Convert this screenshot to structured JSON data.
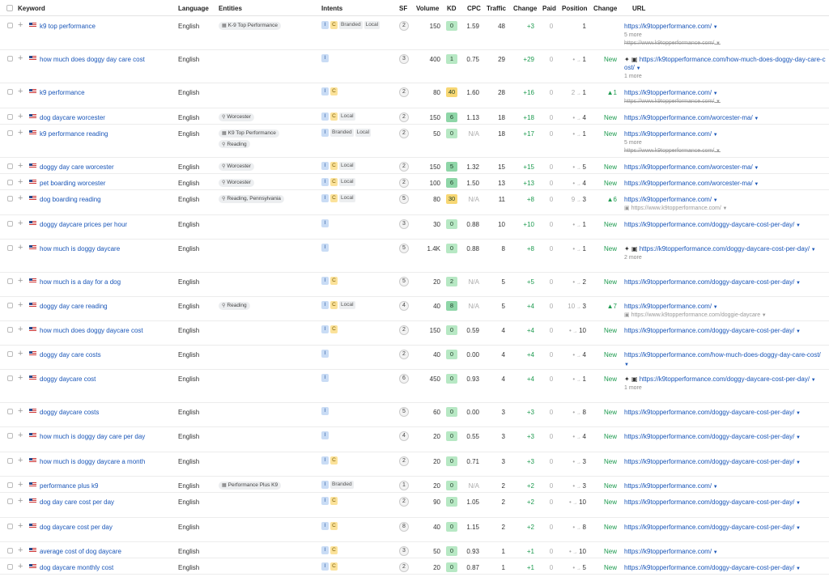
{
  "headers": {
    "keyword": "Keyword",
    "language": "Language",
    "entities": "Entities",
    "intents": "Intents",
    "sf": "SF",
    "volume": "Volume",
    "kd": "KD",
    "cpc": "CPC",
    "traffic": "Traffic",
    "change": "Change",
    "paid": "Paid",
    "position": "Position",
    "position_change": "Change",
    "url": "URL"
  },
  "colors": {
    "link": "#1a56b8",
    "positive": "#1c9a4e",
    "kd_green": "#8fd6a8",
    "kd_light_green": "#b7e8c4",
    "kd_yellow": "#f7d774"
  },
  "rows": [
    {
      "keyword": "k9 top performance",
      "language": "English",
      "entities": [
        {
          "icon": "building-icon",
          "label": "K-9 Top Performance"
        }
      ],
      "intents": [
        "I",
        "C",
        "Branded",
        "Local"
      ],
      "sf": "2",
      "volume": "150",
      "kd": "0",
      "cpc": "1.59",
      "traffic": "48",
      "change": "+3",
      "paid": "0",
      "pos_from": "",
      "pos_to": "1",
      "pos_change": "",
      "url": "https://k9topperformance.com/",
      "url_more": "5 more",
      "url_old": "https://www.k9topperformance.com/",
      "old_strike": true,
      "sparkle": false,
      "h": 41
    },
    {
      "keyword": "how much does doggy day care cost",
      "language": "English",
      "entities": [],
      "intents": [
        "I"
      ],
      "sf": "3",
      "volume": "400",
      "kd": "1",
      "cpc": "0.75",
      "traffic": "29",
      "change": "+29",
      "paid": "0",
      "pos_from": "•",
      "pos_to": "1",
      "pos_change": "New",
      "url": "https://k9topperformance.com/how-much-does-doggy-day-care-cost/",
      "url_more": "1 more",
      "url_old": "",
      "old_strike": false,
      "sparkle": true,
      "h": 41
    },
    {
      "keyword": "k9 performance",
      "language": "English",
      "entities": [],
      "intents": [
        "I",
        "C"
      ],
      "sf": "2",
      "volume": "80",
      "kd": "40",
      "cpc": "1.60",
      "traffic": "28",
      "change": "+16",
      "paid": "0",
      "pos_from": "2",
      "pos_to": "1",
      "pos_change": "▲1",
      "url": "https://k9topperformance.com/",
      "url_more": "",
      "url_old": "https://www.k9topperformance.com/",
      "old_strike": true,
      "sparkle": false,
      "h": 31
    },
    {
      "keyword": "dog daycare worcester",
      "language": "English",
      "entities": [
        {
          "icon": "pin-icon",
          "label": "Worcester"
        }
      ],
      "intents": [
        "I",
        "C",
        "Local"
      ],
      "sf": "2",
      "volume": "150",
      "kd": "6",
      "cpc": "1.13",
      "traffic": "18",
      "change": "+18",
      "paid": "0",
      "pos_from": "•",
      "pos_to": "4",
      "pos_change": "New",
      "url": "https://k9topperformance.com/worcester-ma/",
      "url_more": "",
      "url_old": "",
      "old_strike": false,
      "sparkle": false,
      "h": 20
    },
    {
      "keyword": "k9 performance reading",
      "language": "English",
      "entities": [
        {
          "icon": "building-icon",
          "label": "K9 Top Performance"
        },
        {
          "icon": "pin-icon",
          "label": "Reading"
        }
      ],
      "intents": [
        "I",
        "Branded",
        "Local"
      ],
      "sf": "2",
      "volume": "50",
      "kd": "0",
      "cpc": "N/A",
      "traffic": "18",
      "change": "+17",
      "paid": "0",
      "pos_from": "•",
      "pos_to": "1",
      "pos_change": "New",
      "url": "https://k9topperformance.com/",
      "url_more": "5 more",
      "url_old": "https://www.k9topperformance.com/",
      "old_strike": true,
      "sparkle": false,
      "h": 41
    },
    {
      "keyword": "doggy day care worcester",
      "language": "English",
      "entities": [
        {
          "icon": "pin-icon",
          "label": "Worcester"
        }
      ],
      "intents": [
        "I",
        "C",
        "Local"
      ],
      "sf": "2",
      "volume": "150",
      "kd": "5",
      "cpc": "1.32",
      "traffic": "15",
      "change": "+15",
      "paid": "0",
      "pos_from": "•",
      "pos_to": "5",
      "pos_change": "New",
      "url": "https://k9topperformance.com/worcester-ma/",
      "url_more": "",
      "url_old": "",
      "old_strike": false,
      "sparkle": false,
      "h": 20
    },
    {
      "keyword": "pet boarding worcester",
      "language": "English",
      "entities": [
        {
          "icon": "pin-icon",
          "label": "Worcester"
        }
      ],
      "intents": [
        "I",
        "C",
        "Local"
      ],
      "sf": "2",
      "volume": "100",
      "kd": "6",
      "cpc": "1.50",
      "traffic": "13",
      "change": "+13",
      "paid": "0",
      "pos_from": "•",
      "pos_to": "4",
      "pos_change": "New",
      "url": "https://k9topperformance.com/worcester-ma/",
      "url_more": "",
      "url_old": "",
      "old_strike": false,
      "sparkle": false,
      "h": 20
    },
    {
      "keyword": "dog boarding reading",
      "language": "English",
      "entities": [
        {
          "icon": "pin-icon",
          "label": "Reading, Pennsylvania"
        }
      ],
      "intents": [
        "I",
        "C",
        "Local"
      ],
      "sf": "5",
      "volume": "80",
      "kd": "30",
      "cpc": "N/A",
      "traffic": "11",
      "change": "+8",
      "paid": "0",
      "pos_from": "9",
      "pos_to": "3",
      "pos_change": "▲6",
      "url": "https://k9topperformance.com/",
      "url_more": "",
      "url_old": "https://www.k9topperformance.com/",
      "old_strike": false,
      "sparkle": false,
      "h": 31
    },
    {
      "keyword": "doggy daycare prices per hour",
      "language": "English",
      "entities": [],
      "intents": [
        "I"
      ],
      "sf": "3",
      "volume": "30",
      "kd": "0",
      "cpc": "0.88",
      "traffic": "10",
      "change": "+10",
      "paid": "0",
      "pos_from": "•",
      "pos_to": "1",
      "pos_change": "New",
      "url": "https://k9topperformance.com/doggy-daycare-cost-per-day/",
      "url_more": "",
      "url_old": "",
      "old_strike": false,
      "sparkle": false,
      "h": 30
    },
    {
      "keyword": "how much is doggy daycare",
      "language": "English",
      "entities": [],
      "intents": [
        "I"
      ],
      "sf": "5",
      "volume": "1.4K",
      "kd": "0",
      "cpc": "0.88",
      "traffic": "8",
      "change": "+8",
      "paid": "0",
      "pos_from": "•",
      "pos_to": "1",
      "pos_change": "New",
      "url": "https://k9topperformance.com/doggy-daycare-cost-per-day/",
      "url_more": "2 more",
      "url_old": "",
      "old_strike": false,
      "sparkle": true,
      "h": 41
    },
    {
      "keyword": "how much is a day for a dog",
      "language": "English",
      "entities": [],
      "intents": [
        "I",
        "C"
      ],
      "sf": "5",
      "volume": "20",
      "kd": "2",
      "cpc": "N/A",
      "traffic": "5",
      "change": "+5",
      "paid": "0",
      "pos_from": "•",
      "pos_to": "2",
      "pos_change": "New",
      "url": "https://k9topperformance.com/doggy-daycare-cost-per-day/",
      "url_more": "",
      "url_old": "",
      "old_strike": false,
      "sparkle": false,
      "h": 30
    },
    {
      "keyword": "doggy day care reading",
      "language": "English",
      "entities": [
        {
          "icon": "pin-icon",
          "label": "Reading"
        }
      ],
      "intents": [
        "I",
        "C",
        "Local"
      ],
      "sf": "4",
      "volume": "40",
      "kd": "8",
      "cpc": "N/A",
      "traffic": "5",
      "change": "+4",
      "paid": "0",
      "pos_from": "10",
      "pos_to": "3",
      "pos_change": "▲7",
      "url": "https://k9topperformance.com/",
      "url_more": "",
      "url_old": "https://www.k9topperformance.com/doggie-daycare",
      "old_strike": false,
      "sparkle": false,
      "h": 30
    },
    {
      "keyword": "how much does doggy daycare cost",
      "language": "English",
      "entities": [],
      "intents": [
        "I",
        "C"
      ],
      "sf": "2",
      "volume": "150",
      "kd": "0",
      "cpc": "0.59",
      "traffic": "4",
      "change": "+4",
      "paid": "0",
      "pos_from": "•",
      "pos_to": "10",
      "pos_change": "New",
      "url": "https://k9topperformance.com/doggy-daycare-cost-per-day/",
      "url_more": "",
      "url_old": "",
      "old_strike": false,
      "sparkle": false,
      "h": 30
    },
    {
      "keyword": "doggy day care costs",
      "language": "English",
      "entities": [],
      "intents": [
        "I"
      ],
      "sf": "2",
      "volume": "40",
      "kd": "0",
      "cpc": "0.00",
      "traffic": "4",
      "change": "+4",
      "paid": "0",
      "pos_from": "•",
      "pos_to": "4",
      "pos_change": "New",
      "url": "https://k9topperformance.com/how-much-does-doggy-day-care-cost/",
      "url_more": "",
      "url_old": "",
      "old_strike": false,
      "sparkle": false,
      "h": 30
    },
    {
      "keyword": "doggy daycare cost",
      "language": "English",
      "entities": [],
      "intents": [
        "I"
      ],
      "sf": "6",
      "volume": "450",
      "kd": "0",
      "cpc": "0.93",
      "traffic": "4",
      "change": "+4",
      "paid": "0",
      "pos_from": "•",
      "pos_to": "1",
      "pos_change": "New",
      "url": "https://k9topperformance.com/doggy-daycare-cost-per-day/",
      "url_more": "1 more",
      "url_old": "",
      "old_strike": false,
      "sparkle": true,
      "h": 41
    },
    {
      "keyword": "doggy daycare costs",
      "language": "English",
      "entities": [],
      "intents": [
        "I"
      ],
      "sf": "5",
      "volume": "60",
      "kd": "0",
      "cpc": "0.00",
      "traffic": "3",
      "change": "+3",
      "paid": "0",
      "pos_from": "•",
      "pos_to": "8",
      "pos_change": "New",
      "url": "https://k9topperformance.com/doggy-daycare-cost-per-day/",
      "url_more": "",
      "url_old": "",
      "old_strike": false,
      "sparkle": false,
      "h": 30
    },
    {
      "keyword": "how much is doggy day care per day",
      "language": "English",
      "entities": [],
      "intents": [
        "I"
      ],
      "sf": "4",
      "volume": "20",
      "kd": "0",
      "cpc": "0.55",
      "traffic": "3",
      "change": "+3",
      "paid": "0",
      "pos_from": "•",
      "pos_to": "4",
      "pos_change": "New",
      "url": "https://k9topperformance.com/doggy-daycare-cost-per-day/",
      "url_more": "",
      "url_old": "",
      "old_strike": false,
      "sparkle": false,
      "h": 31
    },
    {
      "keyword": "how much is doggy daycare a month",
      "language": "English",
      "entities": [],
      "intents": [
        "I",
        "C"
      ],
      "sf": "2",
      "volume": "20",
      "kd": "0",
      "cpc": "0.71",
      "traffic": "3",
      "change": "+3",
      "paid": "0",
      "pos_from": "•",
      "pos_to": "3",
      "pos_change": "New",
      "url": "https://k9topperformance.com/doggy-daycare-cost-per-day/",
      "url_more": "",
      "url_old": "",
      "old_strike": false,
      "sparkle": false,
      "h": 30
    },
    {
      "keyword": "performance plus k9",
      "language": "English",
      "entities": [
        {
          "icon": "building-icon",
          "label": "Performance Plus K9"
        }
      ],
      "intents": [
        "I",
        "Branded"
      ],
      "sf": "1",
      "volume": "20",
      "kd": "0",
      "cpc": "N/A",
      "traffic": "2",
      "change": "+2",
      "paid": "0",
      "pos_from": "•",
      "pos_to": "3",
      "pos_change": "New",
      "url": "https://k9topperformance.com/",
      "url_more": "",
      "url_old": "",
      "old_strike": false,
      "sparkle": false,
      "h": 20
    },
    {
      "keyword": "dog day care cost per day",
      "language": "English",
      "entities": [],
      "intents": [
        "I",
        "C"
      ],
      "sf": "2",
      "volume": "90",
      "kd": "0",
      "cpc": "1.05",
      "traffic": "2",
      "change": "+2",
      "paid": "0",
      "pos_from": "•",
      "pos_to": "10",
      "pos_change": "New",
      "url": "https://k9topperformance.com/doggy-daycare-cost-per-day/",
      "url_more": "",
      "url_old": "",
      "old_strike": false,
      "sparkle": false,
      "h": 31
    },
    {
      "keyword": "dog daycare cost per day",
      "language": "English",
      "entities": [],
      "intents": [
        "I",
        "C"
      ],
      "sf": "8",
      "volume": "40",
      "kd": "0",
      "cpc": "1.15",
      "traffic": "2",
      "change": "+2",
      "paid": "0",
      "pos_from": "•",
      "pos_to": "8",
      "pos_change": "New",
      "url": "https://k9topperformance.com/doggy-daycare-cost-per-day/",
      "url_more": "",
      "url_old": "",
      "old_strike": false,
      "sparkle": false,
      "h": 30
    },
    {
      "keyword": "average cost of dog daycare",
      "language": "English",
      "entities": [],
      "intents": [
        "I",
        "C"
      ],
      "sf": "3",
      "volume": "50",
      "kd": "0",
      "cpc": "0.93",
      "traffic": "1",
      "change": "+1",
      "paid": "0",
      "pos_from": "•",
      "pos_to": "10",
      "pos_change": "New",
      "url": "https://k9topperformance.com/",
      "url_more": "",
      "url_old": "",
      "old_strike": false,
      "sparkle": false,
      "h": 20
    },
    {
      "keyword": "dog daycare monthly cost",
      "language": "English",
      "entities": [],
      "intents": [
        "I",
        "C"
      ],
      "sf": "2",
      "volume": "20",
      "kd": "0",
      "cpc": "0.87",
      "traffic": "1",
      "change": "+1",
      "paid": "0",
      "pos_from": "•",
      "pos_to": "5",
      "pos_change": "New",
      "url": "https://k9topperformance.com/doggy-daycare-cost-per-day/",
      "url_more": "",
      "url_old": "",
      "old_strike": false,
      "sparkle": false,
      "h": 20
    }
  ]
}
